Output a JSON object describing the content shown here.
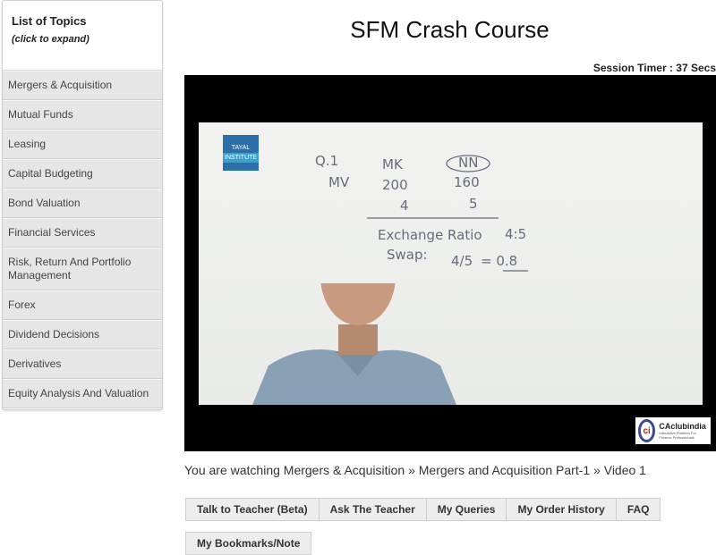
{
  "sidebar": {
    "title": "List of Topics",
    "subtitle": "(click to expand)",
    "topics": [
      "Mergers & Acquisition",
      "Mutual Funds",
      "Leasing",
      "Capital Budgeting",
      "Bond Valuation",
      "Financial Services",
      "Risk, Return And Portfolio Management",
      "Forex",
      "Dividend Decisions",
      "Derivatives",
      "Equity Analysis And Valuation"
    ]
  },
  "header": {
    "title": "SFM Crash Course",
    "timer": "Session Timer : 37 Secs"
  },
  "video": {
    "institute_logo": [
      "TAYAL",
      "INSTITUTE"
    ],
    "board_text": [
      "Q.1",
      "MK",
      "NN",
      "MV",
      "200",
      "160",
      "4",
      "5",
      "Exchange Ratio",
      "4:5",
      "Swap:",
      "4/5",
      "= 0.8"
    ],
    "watermark": {
      "name": "CAclubindia",
      "tagline": "Interactive Platform For Finance Professionals"
    }
  },
  "breadcrumb": "You are watching Mergers & Acquisition » Mergers and Acquisition Part-1 » Video 1",
  "actions": {
    "talk": "Talk to Teacher (Beta)",
    "ask": "Ask The Teacher",
    "queries": "My Queries",
    "orders": "My Order History",
    "faq": "FAQ",
    "bookmarks": "My Bookmarks/Note"
  }
}
